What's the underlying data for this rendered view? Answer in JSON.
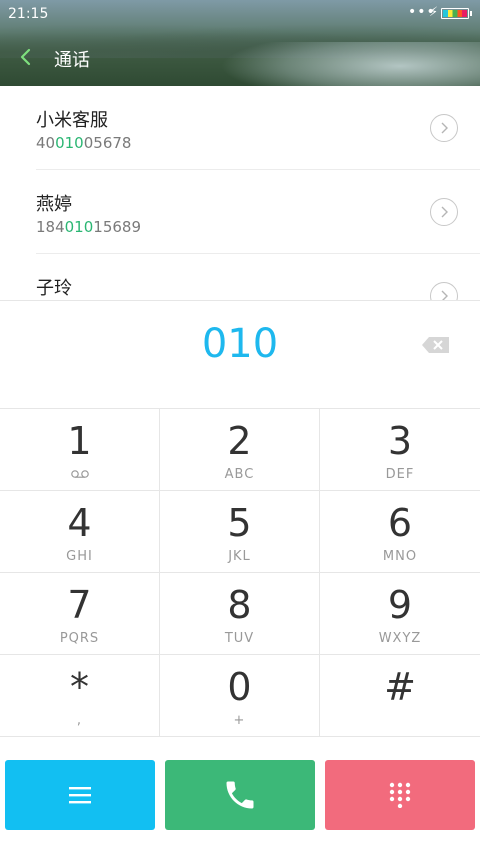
{
  "status_bar": {
    "time": "21:15",
    "signal": "•••",
    "charging": "⚡"
  },
  "header": {
    "title": "通话"
  },
  "contacts": [
    {
      "name": "小米客服",
      "number_pre": "40",
      "number_match": "010",
      "number_post": "05678"
    },
    {
      "name": "燕婷",
      "number_pre": "184",
      "number_match": "010",
      "number_post": "15689"
    },
    {
      "name": "子玲",
      "number_pre": "",
      "number_match": "",
      "number_post": ""
    }
  ],
  "display": {
    "digits": "010"
  },
  "keypad": [
    {
      "digit": "1",
      "letters": ""
    },
    {
      "digit": "2",
      "letters": "ABC"
    },
    {
      "digit": "3",
      "letters": "DEF"
    },
    {
      "digit": "4",
      "letters": "GHI"
    },
    {
      "digit": "5",
      "letters": "JKL"
    },
    {
      "digit": "6",
      "letters": "MNO"
    },
    {
      "digit": "7",
      "letters": "PQRS"
    },
    {
      "digit": "8",
      "letters": "TUV"
    },
    {
      "digit": "9",
      "letters": "WXYZ"
    },
    {
      "digit": "*",
      "letters": ","
    },
    {
      "digit": "0",
      "letters": "+"
    },
    {
      "digit": "#",
      "letters": ""
    }
  ],
  "colors": {
    "accent_blue": "#1eb8ee",
    "match_green": "#2bb673",
    "menu_button": "#12bff2",
    "call_button": "#3cb878",
    "keypad_button": "#f26b7d"
  },
  "icons": {
    "back": "chevron-left-icon",
    "detail": "chevron-right-icon",
    "voicemail": "voicemail-icon",
    "backspace": "backspace-icon",
    "menu": "menu-icon",
    "call": "phone-icon",
    "keypad": "dialpad-icon"
  }
}
